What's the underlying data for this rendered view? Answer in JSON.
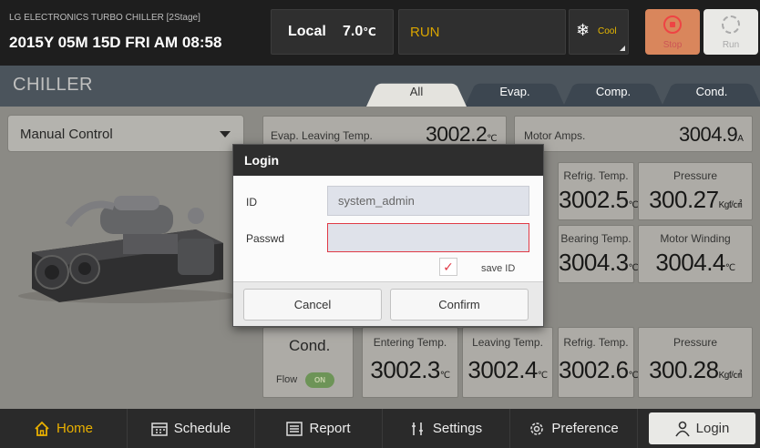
{
  "header": {
    "brand": "LG ELECTRONICS TURBO CHILLER [2Stage]",
    "datetime": "2015Y 05M 15D  FRI AM 08:58",
    "mode": "Local",
    "temp_value": "7.0",
    "temp_unit": "℃",
    "run_state": "RUN",
    "cool_label": "Cool",
    "stop_label": "Stop",
    "run_label": "Run"
  },
  "tabs": {
    "section_title": "CHILLER",
    "items": [
      "All",
      "Evap.",
      "Comp.",
      "Cond."
    ],
    "active": "All"
  },
  "control": {
    "mode_select": "Manual Control"
  },
  "panels": {
    "evap_leaving_label": "Evap. Leaving Temp.",
    "evap_leaving_value": "3002.2",
    "evap_leaving_unit": "℃",
    "motor_amps_label": "Motor Amps.",
    "motor_amps_value": "3004.9",
    "motor_amps_unit": "A",
    "refrig_temp_1_label": "Refrig. Temp.",
    "refrig_temp_1_value": "3002.5",
    "refrig_temp_1_unit": "℃",
    "pressure_1_label": "Pressure",
    "pressure_1_value": "300.27",
    "pressure_1_unit": "Kgf/㎠",
    "bearing_temp_label": "Bearing Temp.",
    "bearing_temp_value": "3004.3",
    "bearing_temp_unit": "℃",
    "motor_winding_label": "Motor Winding",
    "motor_winding_value": "3004.4",
    "motor_winding_unit": "℃",
    "cond_label": "Cond.",
    "flow_label": "Flow",
    "flow_state": "ON",
    "entering_temp_label": "Entering Temp.",
    "entering_temp_value": "3002.3",
    "entering_temp_unit": "℃",
    "leaving_temp_label": "Leaving Temp.",
    "leaving_temp_value": "3002.4",
    "leaving_temp_unit": "℃",
    "refrig_temp_2_label": "Refrig. Temp.",
    "refrig_temp_2_value": "3002.6",
    "refrig_temp_2_unit": "℃",
    "pressure_2_label": "Pressure",
    "pressure_2_value": "300.28",
    "pressure_2_unit": "Kgf/㎠"
  },
  "dialog": {
    "title": "Login",
    "id_label": "ID",
    "id_value": "system_admin",
    "password_label": "Passwd",
    "save_id_label": "save ID",
    "save_id_checked": true,
    "check_glyph": "✓",
    "cancel_label": "Cancel",
    "confirm_label": "Confirm"
  },
  "nav": {
    "home": "Home",
    "schedule": "Schedule",
    "report": "Report",
    "settings": "Settings",
    "preference": "Preference",
    "login": "Login"
  },
  "colors": {
    "accent": "#e9b000",
    "error_border": "#e03a46",
    "flow_on": "#78a85f"
  }
}
